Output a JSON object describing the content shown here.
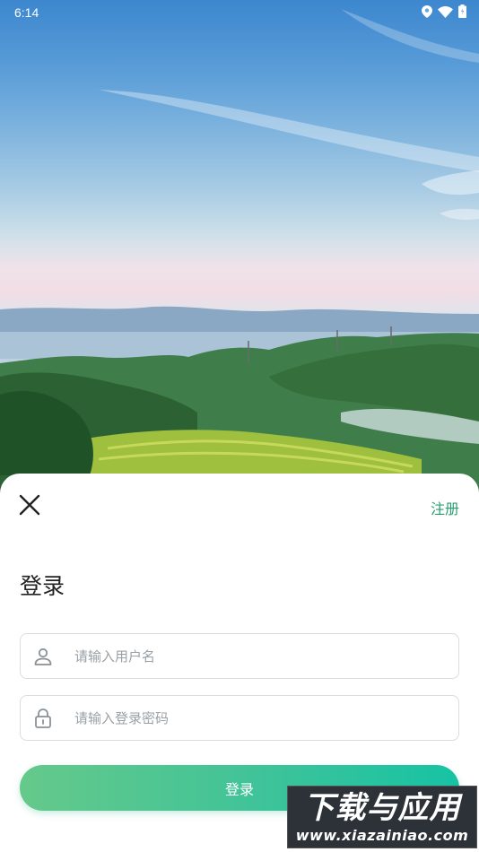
{
  "status_bar": {
    "time": "6:14",
    "icons": [
      "location-icon",
      "wifi-icon",
      "battery-icon"
    ]
  },
  "header": {
    "close_icon": "close-icon",
    "register_label": "注册"
  },
  "login": {
    "title": "登录",
    "username": {
      "placeholder": "请输入用户名",
      "value": "",
      "icon": "user-icon"
    },
    "password": {
      "placeholder": "请输入登录密码",
      "value": "",
      "icon": "lock-icon"
    },
    "submit_label": "登录"
  },
  "colors": {
    "accent": "#2a9d6f",
    "button_gradient_start": "#65c98a",
    "button_gradient_end": "#16c3a4"
  },
  "watermark": {
    "title": "下载与应用",
    "url": "www.xiazainiao.com"
  }
}
